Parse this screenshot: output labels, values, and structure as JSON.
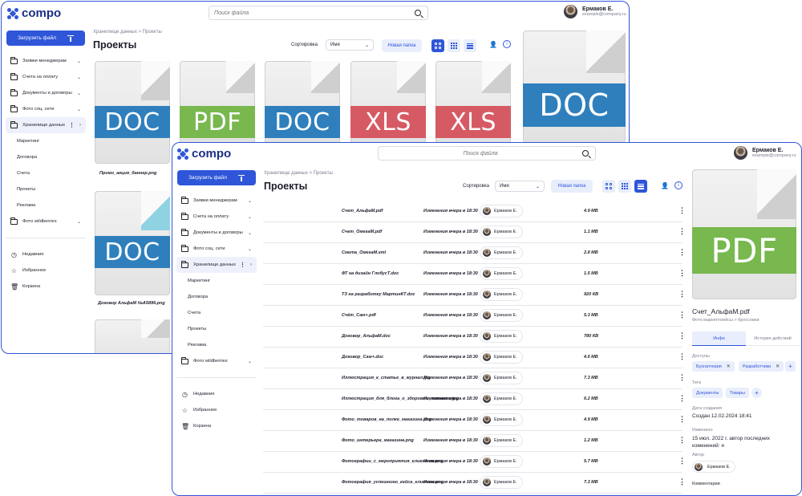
{
  "app": {
    "logo_text": "compo"
  },
  "header": {
    "search_placeholder": "Поиск файла",
    "user_name": "Ермаков Е.",
    "user_email": "example@company.ru"
  },
  "sidebar": {
    "upload_label": "Загрузить файл",
    "folders": [
      {
        "label": "Заявки менеджерам"
      },
      {
        "label": "Счета на оплату"
      },
      {
        "label": "Документы и договоры"
      },
      {
        "label": "Фото соц. сети"
      },
      {
        "label": "Хранилище данных"
      }
    ],
    "subfolders": [
      {
        "label": "Маркетинг"
      },
      {
        "label": "Договора"
      },
      {
        "label": "Счета"
      },
      {
        "label": "Проекты"
      },
      {
        "label": "Реклама"
      }
    ],
    "extra_folder": "Фото wildberries",
    "recent": "Недавние",
    "favorites": "Избранное",
    "trash": "Корзина"
  },
  "main": {
    "breadcrumb": "Хранилище данных > Проекты",
    "title": "Проекты",
    "sort_label": "Сортировка",
    "sort_value": "Имя",
    "new_folder": "Новая папка"
  },
  "back_grid": {
    "tiles": [
      {
        "type": "DOC",
        "color": "#2f7fbd"
      },
      {
        "type": "PDF",
        "color": "#78b84e"
      },
      {
        "type": "DOC",
        "color": "#2f7fbd"
      },
      {
        "type": "XLS",
        "color": "#d65a64"
      },
      {
        "type": "XLS",
        "color": "#d65a64"
      },
      {
        "type": "DOC",
        "color": "#2f7fbd"
      },
      {
        "type": "DOC",
        "color": "#2f7fbd"
      }
    ],
    "captions": [
      "Промо_акция_баннер.png",
      "Договор АльфаМ №А5896.png"
    ]
  },
  "files": [
    {
      "name": "Счет_АльфаМ.pdf",
      "changed": "Изменения вчера в 18:30",
      "author": "Ермаков Е.",
      "size": "4.9 МВ"
    },
    {
      "name": "Счет_ОмегаМ.pdf",
      "changed": "Изменения вчера в 18:30",
      "author": "Ермаков Е.",
      "size": "1.1 МВ"
    },
    {
      "name": "Смета_ОмегаМ.xml",
      "changed": "Изменения вчера в 18:30",
      "author": "Ермаков Е.",
      "size": "2.8 МВ"
    },
    {
      "name": "ФТ на дизайн ГлобусТ.doc",
      "changed": "Изменения вчера в 18:30",
      "author": "Ермаков Е.",
      "size": "1.5 МВ"
    },
    {
      "name": "ТЗ на разработку МартинКТ.doc",
      "changed": "Изменения вчера в 18:30",
      "author": "Ермаков Е.",
      "size": "920 КВ"
    },
    {
      "name": "Счёт_Сам+.pdf",
      "changed": "Изменения вчера в 18:30",
      "author": "Ермаков Е.",
      "size": "5.3 МВ"
    },
    {
      "name": "Договор_АльфаМ.doc",
      "changed": "Изменения вчера в 18:30",
      "author": "Ермаков Е.",
      "size": "780 КВ"
    },
    {
      "name": "Договор_Сам+.doc",
      "changed": "Изменения вчера в 18:30",
      "author": "Ермаков Е.",
      "size": "4.6 МВ"
    },
    {
      "name": "Иллюстрация_к_статье_в_журнал.jpg",
      "changed": "Изменения вчера в 18:30",
      "author": "Ермаков Е.",
      "size": "7.3 МВ"
    },
    {
      "name": "Иллюстрация_для_блога_о_здоровом_питании.jpg",
      "changed": "Изменения вчера в 18:30",
      "author": "Ермаков Е.",
      "size": "6.2 МВ"
    },
    {
      "name": "Фото_товаров_на_полке_магазина.png",
      "changed": "Изменения вчера в 18:30",
      "author": "Ермаков Е.",
      "size": "4.9 МВ"
    },
    {
      "name": "Фото_интерьера_магазина.png",
      "changed": "Изменения вчера в 18:30",
      "author": "Ермаков Е.",
      "size": "1.2 МВ"
    },
    {
      "name": "Фотографии_с_мероприятия_клиентов.png",
      "changed": "Изменения вчера в 18:30",
      "author": "Ермаков Е.",
      "size": "5.7 МВ"
    },
    {
      "name": "Фотография_успешного_кейса_клиента.png",
      "changed": "Изменения вчера в 18:30",
      "author": "Ермаков Е.",
      "size": "7.3 МВ"
    }
  ],
  "panel": {
    "preview_type": "PDF",
    "preview_color": "#78b84e",
    "file_name": "Счет_АльфаМ.pdf",
    "path": "Фото маркетплейсы > Кроссовки",
    "tab_info": "Инфо",
    "tab_history": "История действий",
    "access_label": "Доступы",
    "access_chips": [
      "Бухгалтерия",
      "Разработчики"
    ],
    "tags_label": "Теги",
    "tags": [
      "Документы",
      "Товары"
    ],
    "created_label": "Дата создания",
    "created_value": "Создан 12.02.2024 18:41",
    "modified_label": "Изменено",
    "modified_value": "15 июл. 2022 г. автор последних изменений: я",
    "author_label": "Автор",
    "author_value": "Ермаков Е.",
    "comments_label": "Комментарии"
  }
}
